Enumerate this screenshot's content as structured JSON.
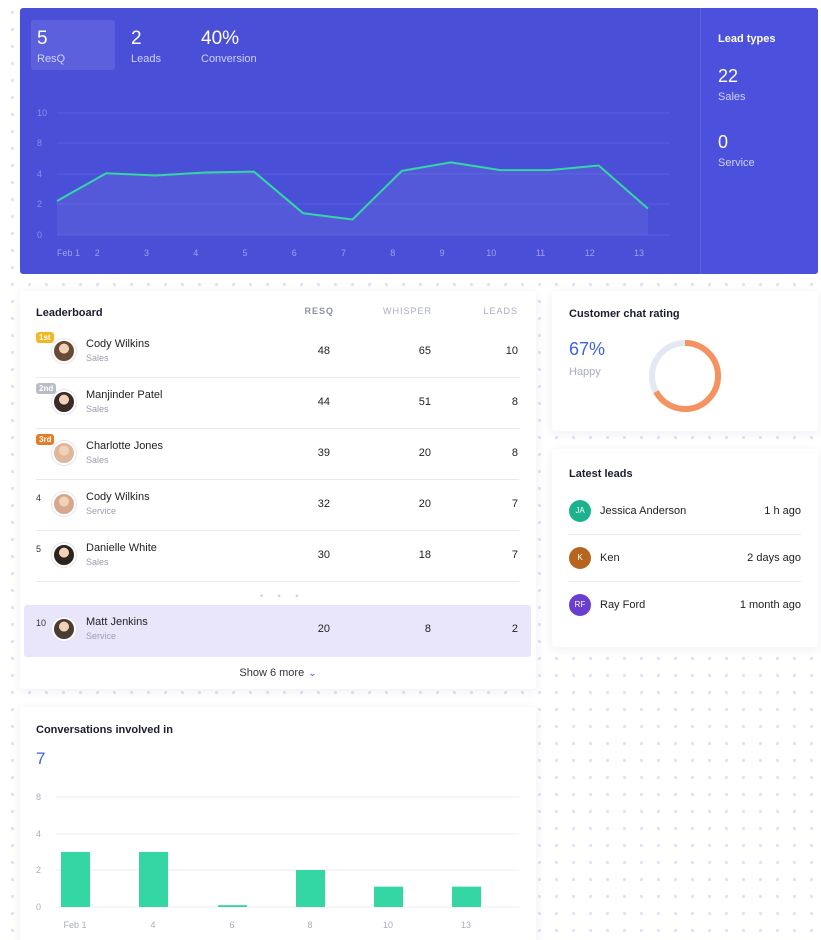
{
  "hero": {
    "stats": [
      {
        "value": "5",
        "label": "ResQ"
      },
      {
        "value": "2",
        "label": "Leads"
      },
      {
        "value": "40%",
        "label": "Conversion"
      }
    ],
    "chart_data": {
      "type": "area",
      "x": [
        "Feb 1",
        "2",
        "3",
        "4",
        "5",
        "6",
        "7",
        "8",
        "9",
        "10",
        "11",
        "12",
        "13"
      ],
      "y_ticks": [
        "10",
        "8",
        "4",
        "2",
        "0"
      ],
      "ylim": [
        0,
        10
      ],
      "values": [
        2.2,
        4.1,
        3.9,
        4.2,
        4.3,
        1.4,
        1.0,
        4.4,
        5.5,
        4.5,
        4.5,
        5.1,
        1.7
      ],
      "color": "#34d6a4",
      "grid": true
    }
  },
  "lead_types": {
    "title": "Lead types",
    "items": [
      {
        "value": "22",
        "label": "Sales"
      },
      {
        "value": "0",
        "label": "Service"
      }
    ]
  },
  "leaderboard": {
    "title": "Leaderboard",
    "columns": [
      "RESQ",
      "WHISPER",
      "LEADS"
    ],
    "rows": [
      {
        "rank": "1st",
        "name": "Cody Wilkins",
        "team": "Sales",
        "resq": "48",
        "whisper": "65",
        "leads": "10",
        "badge_color": "#f2b824",
        "avatar_color": "#6b4a35"
      },
      {
        "rank": "2nd",
        "name": "Manjinder Patel",
        "team": "Sales",
        "resq": "44",
        "whisper": "51",
        "leads": "8",
        "badge_color": "#b7bcc6",
        "avatar_color": "#3a2a28"
      },
      {
        "rank": "3rd",
        "name": "Charlotte Jones",
        "team": "Sales",
        "resq": "39",
        "whisper": "20",
        "leads": "8",
        "badge_color": "#e57a27",
        "avatar_color": "#e0b79a"
      },
      {
        "rank": "4",
        "name": "Cody Wilkins",
        "team": "Service",
        "resq": "32",
        "whisper": "20",
        "leads": "7",
        "badge_color": "",
        "avatar_color": "#d8a68c"
      },
      {
        "rank": "5",
        "name": "Danielle White",
        "team": "Sales",
        "resq": "30",
        "whisper": "18",
        "leads": "7",
        "badge_color": "",
        "avatar_color": "#2d221d"
      },
      {
        "rank": "10",
        "name": "Matt Jenkins",
        "team": "Service",
        "resq": "20",
        "whisper": "8",
        "leads": "2",
        "badge_color": "",
        "avatar_color": "#4a3b34"
      }
    ],
    "ellipsis": "• • •",
    "show_more": "Show 6 more",
    "show_more_icon": "chevron-down-icon"
  },
  "chat_rating": {
    "title": "Customer chat rating",
    "percent": "67%",
    "label": "Happy",
    "value": 0.67,
    "color": "#f4935f",
    "track_color": "#e3e8f2"
  },
  "latest_leads": {
    "title": "Latest leads",
    "items": [
      {
        "initials": "JA",
        "name": "Jessica Anderson",
        "time": "1 h ago",
        "color": "#1bb28d"
      },
      {
        "initials": "K",
        "name": "Ken",
        "time": "2 days ago",
        "color": "#b5651d"
      },
      {
        "initials": "RF",
        "name": "Ray Ford",
        "time": "1 month ago",
        "color": "#6a3fd0"
      }
    ]
  },
  "conversations": {
    "title": "Conversations involved in",
    "count": "7",
    "chart_data": {
      "type": "bar",
      "categories": [
        "Feb 1",
        "4",
        "6",
        "8",
        "10",
        "13"
      ],
      "values": [
        3,
        3,
        0.1,
        2,
        1.1,
        1.1
      ],
      "y_ticks": [
        "8",
        "4",
        "2",
        "0"
      ],
      "ylim": [
        0,
        8
      ],
      "color": "#34d6a4",
      "grid": true
    }
  }
}
